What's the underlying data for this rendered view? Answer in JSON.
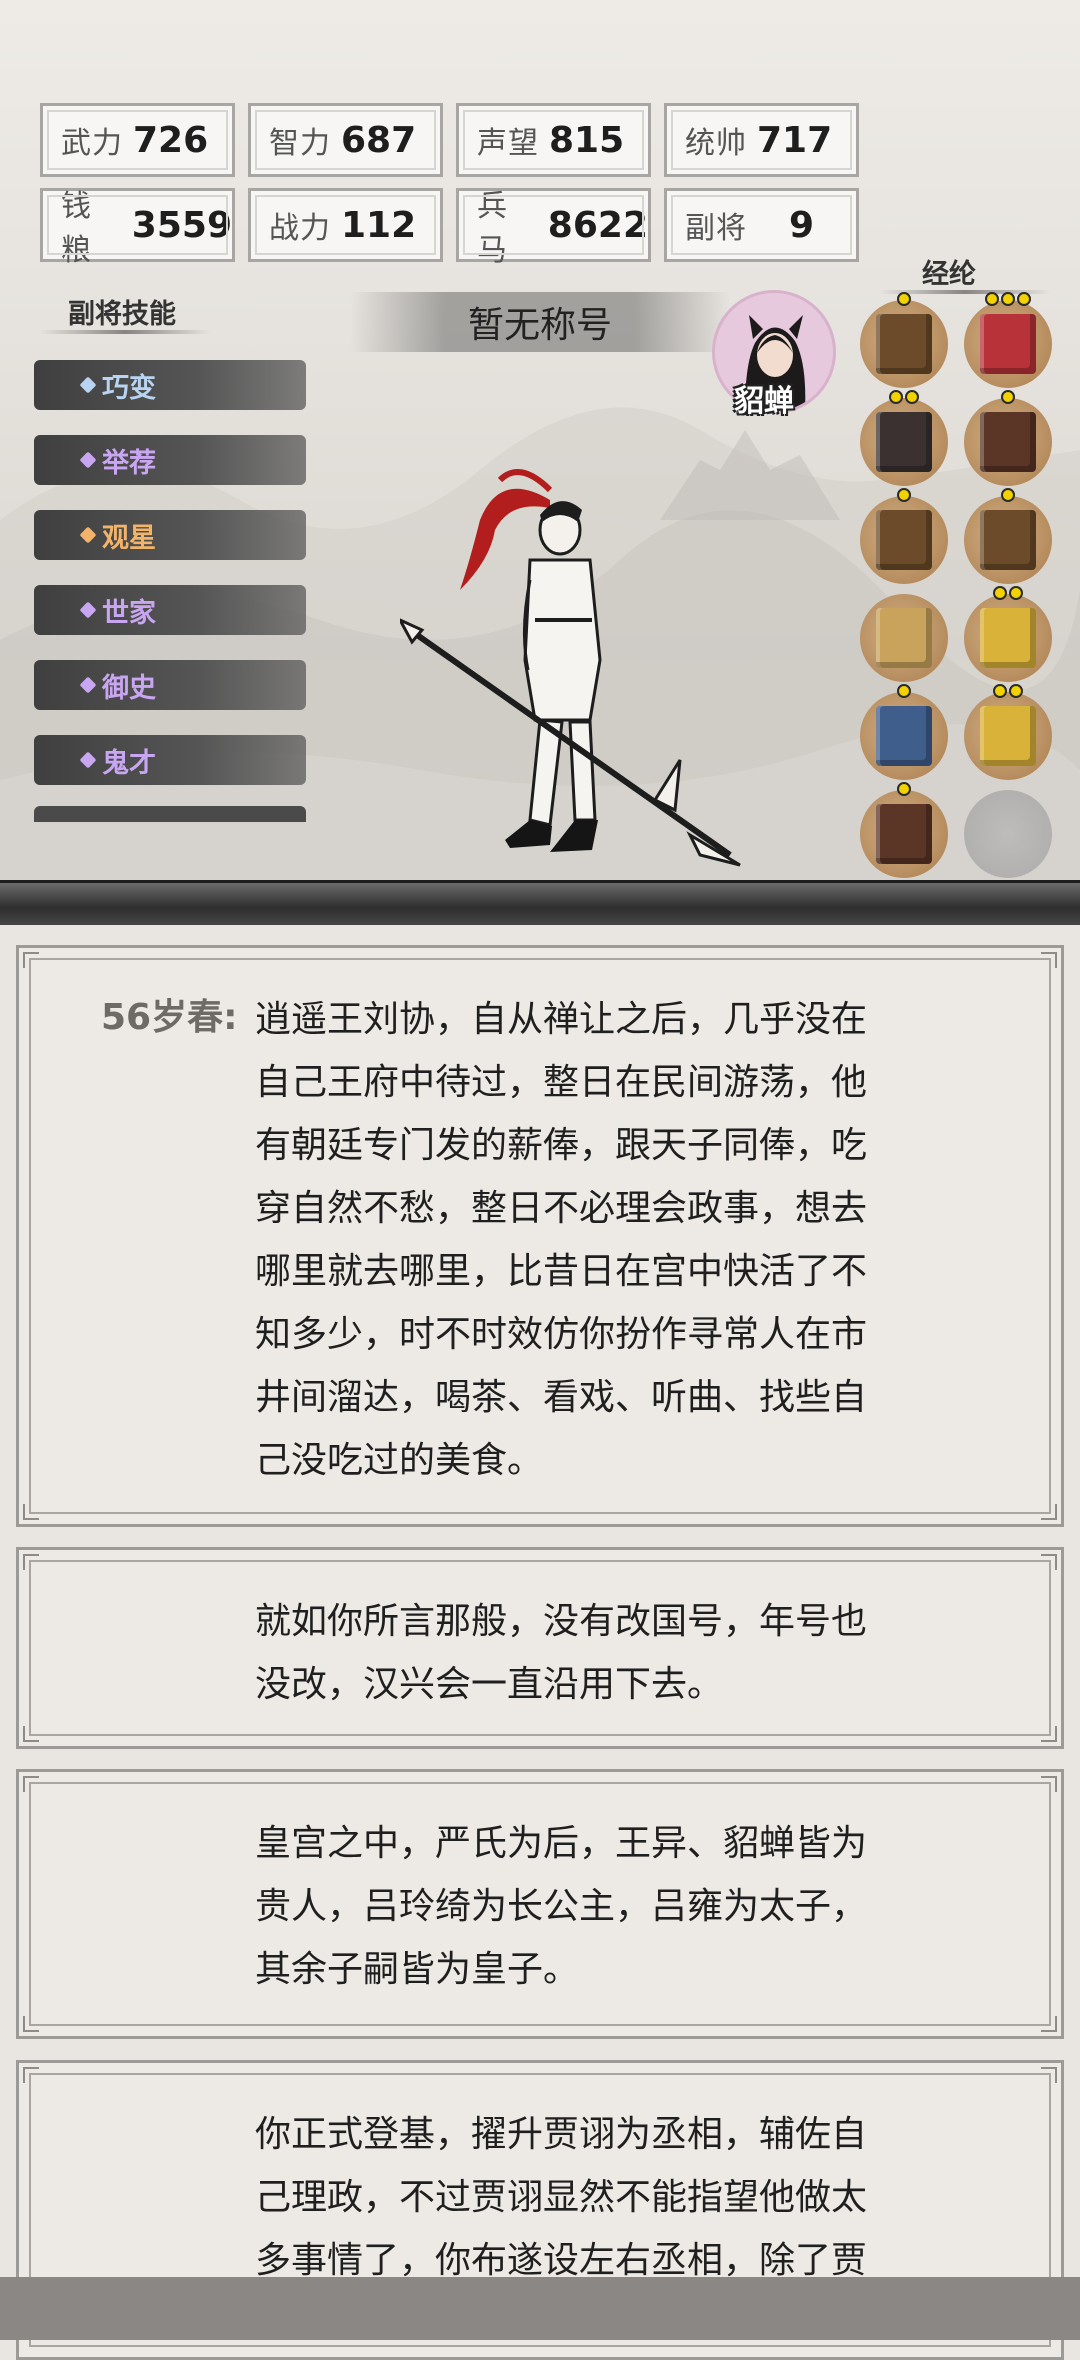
{
  "stats": [
    {
      "label": "武力",
      "value": "726"
    },
    {
      "label": "智力",
      "value": "687"
    },
    {
      "label": "声望",
      "value": "815"
    },
    {
      "label": "统帅",
      "value": "717"
    },
    {
      "label": "钱粮",
      "value": "3559"
    },
    {
      "label": "战力",
      "value": "112"
    },
    {
      "label": "兵马",
      "value": "8622"
    },
    {
      "label": "副将",
      "value": "9"
    }
  ],
  "skills": {
    "title": "副将技能",
    "items": [
      {
        "name": "巧变",
        "color": "#b9d3f2"
      },
      {
        "name": "举荐",
        "color": "#c9a6f2"
      },
      {
        "name": "观星",
        "color": "#f2b36a"
      },
      {
        "name": "世家",
        "color": "#c9a6f2"
      },
      {
        "name": "御史",
        "color": "#c9a6f2"
      },
      {
        "name": "鬼才",
        "color": "#c9a6f2"
      }
    ]
  },
  "title_banner": "暂无称号",
  "spouse": {
    "name": "貂蝉"
  },
  "jinglun": {
    "title": "经纶",
    "books": [
      {
        "icon": "scroll-icon",
        "stars": 1,
        "color": "#6b4b2a"
      },
      {
        "icon": "red-book-icon",
        "stars": 3,
        "color": "#b8323a"
      },
      {
        "icon": "dark-book-icon",
        "stars": 2,
        "color": "#3a3130"
      },
      {
        "icon": "brown-book-icon",
        "stars": 1,
        "color": "#5b3526"
      },
      {
        "icon": "scroll-icon",
        "stars": 1,
        "color": "#6b4b2a"
      },
      {
        "icon": "scroll-icon",
        "stars": 1,
        "color": "#6b4b2a"
      },
      {
        "icon": "open-book-icon",
        "stars": 0,
        "color": "#c9a35c"
      },
      {
        "icon": "gold-book-icon",
        "stars": 2,
        "color": "#d9b23a"
      },
      {
        "icon": "blue-box-icon",
        "stars": 1,
        "color": "#3f5e8c"
      },
      {
        "icon": "gold-book-icon",
        "stars": 2,
        "color": "#d9b23a"
      },
      {
        "icon": "brown-book-icon",
        "stars": 1,
        "color": "#5b3526"
      },
      {
        "icon": "empty-slot-icon",
        "stars": 0,
        "color": ""
      }
    ]
  },
  "story": [
    {
      "age": "56岁春:",
      "lines": [
        "逍遥王刘协，自从禅让之后，几乎没在",
        "自己王府中待过，整日在民间游荡，他",
        "有朝廷专门发的薪俸，跟天子同俸，吃",
        "穿自然不愁，整日不必理会政事，想去",
        "哪里就去哪里，比昔日在宫中快活了不",
        "知多少，时不时效仿你扮作寻常人在市",
        "井间溜达，喝茶、看戏、听曲、找些自",
        "己没吃过的美食。"
      ]
    },
    {
      "age": "",
      "lines": [
        "就如你所言那般，没有改国号，年号也",
        "没改，汉兴会一直沿用下去。"
      ]
    },
    {
      "age": "",
      "lines": [
        "皇宫之中，严氏为后，王异、貂蝉皆为",
        "贵人，吕玲绮为长公主，吕雍为太子，",
        "其余子嗣皆为皇子。"
      ]
    },
    {
      "age": "",
      "lines": [
        "你正式登基，擢升贾诩为丞相，辅佐自",
        "己理政，不过贾诩显然不能指望他做太",
        "多事情了，你布遂设左右丞相，除了贾"
      ]
    }
  ]
}
